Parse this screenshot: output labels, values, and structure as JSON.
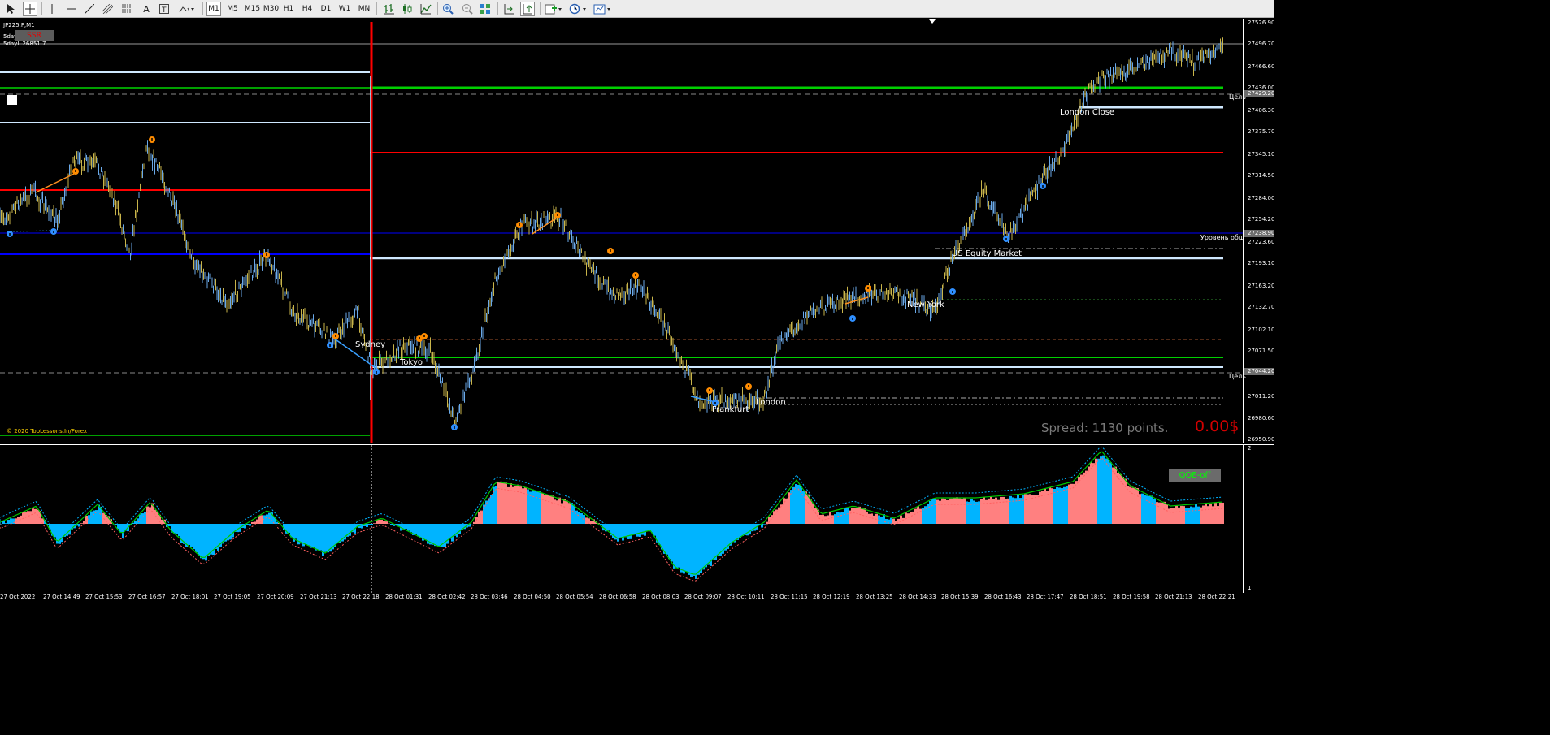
{
  "toolbar": {
    "timeframes": [
      {
        "label": "M1",
        "active": true
      },
      {
        "label": "M5",
        "active": false
      },
      {
        "label": "M15",
        "active": false
      },
      {
        "label": "M30",
        "active": false
      },
      {
        "label": "H1",
        "active": false
      },
      {
        "label": "H4",
        "active": false
      },
      {
        "label": "D1",
        "active": false
      },
      {
        "label": "W1",
        "active": false
      },
      {
        "label": "MN",
        "active": false
      }
    ],
    "icons": [
      "cursor-icon",
      "crosshair-icon",
      "vertical-line-icon",
      "horizontal-line-icon",
      "trendline-icon",
      "channel-icon",
      "fibonacci-icon",
      "text-icon",
      "text-label-icon",
      "shapes-icon",
      "bar-chart-icon",
      "candlestick-icon",
      "line-chart-icon",
      "zoom-in-icon",
      "zoom-out-icon",
      "tile-windows-icon",
      "autoscroll-icon",
      "chart-shift-icon",
      "indicators-icon",
      "periodicity-icon",
      "templates-icon"
    ]
  },
  "chart": {
    "symbol": "JP225.F,M1",
    "ssr_badge": "SSR",
    "five_day_high": "5dayH 27621.7",
    "five_day_low": "5dayL 26851.7",
    "copyright": "© 2020 TopLessons.In/Forex",
    "spread": "Spread: 1130 points.",
    "profit": "0.00$",
    "qqe_button": "QQE-off",
    "sessions": [
      "Sydney",
      "Tokyo",
      "Frankfurt",
      "London",
      "New York",
      "US Equity Market",
      "London Close"
    ],
    "side_labels": [
      "Цель",
      "Уровень общ",
      "Цель"
    ],
    "price_axis": [
      "27526.90",
      "27496.70",
      "27466.60",
      "27436.00",
      "27406.30",
      "27375.70",
      "27345.10",
      "27314.50",
      "27284.00",
      "27254.20",
      "27223.60",
      "27193.10",
      "27163.20",
      "27132.70",
      "27102.10",
      "27071.50",
      "27011.20",
      "26980.60",
      "26950.90"
    ],
    "highlight_prices": [
      "27429.20",
      "27238.90",
      "27044.20"
    ],
    "indicator_scale": [
      "2",
      "1"
    ],
    "time_axis": [
      "27 Oct 2022",
      "27 Oct 14:49",
      "27 Oct 15:53",
      "27 Oct 16:57",
      "27 Oct 18:01",
      "27 Oct 19:05",
      "27 Oct 20:09",
      "27 Oct 21:13",
      "27 Oct 22:18",
      "28 Oct 01:31",
      "28 Oct 02:42",
      "28 Oct 03:46",
      "28 Oct 04:50",
      "28 Oct 05:54",
      "28 Oct 06:58",
      "28 Oct 08:03",
      "28 Oct 09:07",
      "28 Oct 10:11",
      "28 Oct 11:15",
      "28 Oct 12:19",
      "28 Oct 13:25",
      "28 Oct 14:33",
      "28 Oct 15:39",
      "28 Oct 16:43",
      "28 Oct 17:47",
      "28 Oct 18:51",
      "28 Oct 19:58",
      "28 Oct 21:13",
      "28 Oct 22:21"
    ]
  },
  "colors": {
    "bull": "#00b4ff",
    "bear": "#ff8080",
    "accent_green": "#00c800",
    "accent_red": "#ff0000",
    "level_blue": "#0000ff",
    "level_light": "#cfe8ff"
  }
}
